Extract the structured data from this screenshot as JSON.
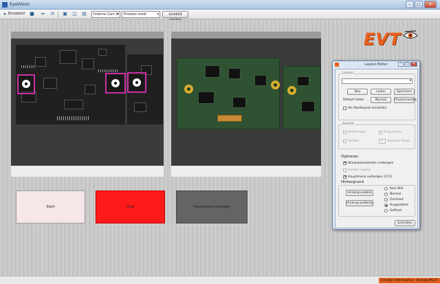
{
  "window": {
    "title": "EyeVision",
    "minimize": "–",
    "maximize": "□",
    "close": "✕"
  },
  "toolbar": {
    "mode_label": "Einzelbild",
    "camera_select": "Interne Cam 0",
    "process_select": "Prozess modi",
    "live_button": "Livebild starten",
    "icons": [
      "play-icon",
      "stop-icon",
      "step-icon",
      "cycle-icon",
      "save-icon",
      "open-icon",
      "layout-icon",
      "camera-icon"
    ]
  },
  "logo": {
    "text": "EVT"
  },
  "buttons": {
    "start": {
      "label": "Start",
      "color": "#f6e6e8"
    },
    "stop": {
      "label": "Stop",
      "color": "#ff1a1a"
    },
    "main_window": {
      "label": "Hauptmenü anzeigen",
      "color": "#646464"
    }
  },
  "layout_editor": {
    "title": "Layout Editor",
    "layout_group": "Layout",
    "layout_combo_value": "",
    "neu": "Neu",
    "laden": "Laden",
    "speichern": "Speichern",
    "default_laden_label": "Default laden",
    "normal": "Normal",
    "prozessmodus": "Prozessmodus",
    "startlayout_label": "Als Startlayout einstellen",
    "ansicht_group": "Ansicht",
    "befehlssatz": "Befehlssatz",
    "programme": "Programme",
    "toolbar": "Toolbar",
    "kamera_views": "Kamera Views",
    "kamera_views_value": "1",
    "optionen_title": "Optionen",
    "windows_taskbar": "Windowstaskleiste verbergen",
    "fenster_layout": "Fenster Layout",
    "hauptmenu_verbergen": "Hauptmenü verbergen (F11)",
    "hintergrund_title": "Hintergrund",
    "hintergrundbild": "Hintergrundbild",
    "hintergrundfarbe": "Hintergrundfarbe",
    "radio_options": [
      "Kein Bild",
      "Normal",
      "Zentriert",
      "Ausgedehnt",
      "Gefliest"
    ],
    "radio_selected": 3,
    "schliessen": "Schließen"
  },
  "status": {
    "license": "Dongle Information: Dongle/M/23"
  },
  "colors": {
    "accent": "#e8601c",
    "marker": "#cc30a9",
    "stop_red": "#ff1a1a"
  }
}
